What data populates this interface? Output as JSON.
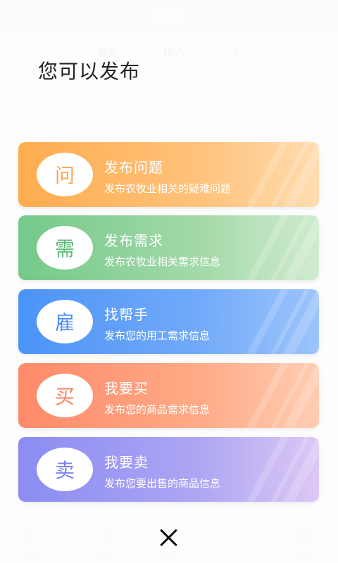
{
  "background": {
    "header_title": "问答",
    "tabs": [
      "最新",
      "精选"
    ],
    "plus_glyph": "+",
    "nav": [
      "首页",
      "服务",
      "发布",
      "",
      "我的"
    ]
  },
  "dialog": {
    "title": "您可以发布",
    "cards": [
      {
        "badge": "问",
        "badge_color": "#ffa64a",
        "title": "发布问题",
        "subtitle": "发布农牧业相关的疑难问题"
      },
      {
        "badge": "需",
        "badge_color": "#5cbc74",
        "title": "发布需求",
        "subtitle": "发布农牧业相关需求信息"
      },
      {
        "badge": "雇",
        "badge_color": "#4c8ff7",
        "title": "找帮手",
        "subtitle": "发布您的用工需求信息"
      },
      {
        "badge": "买",
        "badge_color": "#ff7e5e",
        "title": "我要买",
        "subtitle": "发布您的商品需求信息"
      },
      {
        "badge": "卖",
        "badge_color": "#7d7ff0",
        "title": "我要卖",
        "subtitle": "发布您要出售的商品信息"
      }
    ],
    "close_icon": "close-icon"
  }
}
